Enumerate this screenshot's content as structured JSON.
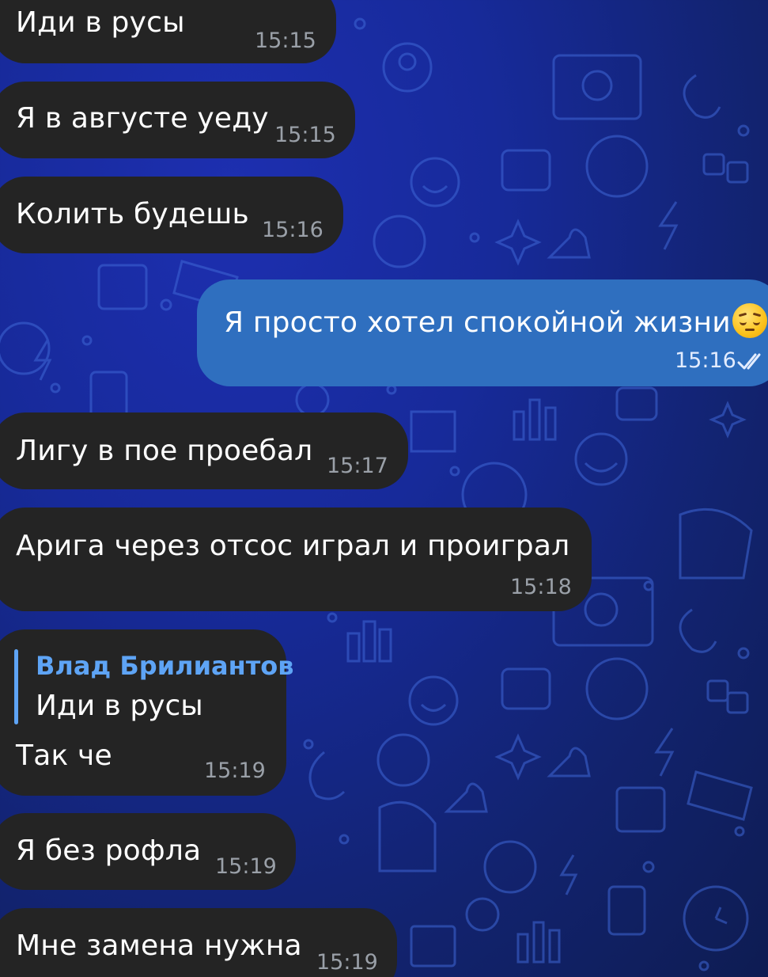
{
  "messages": [
    {
      "direction": "in",
      "text": "Иди в русы",
      "time": "15:15"
    },
    {
      "direction": "in",
      "text": "Я в августе уеду",
      "time": "15:15"
    },
    {
      "direction": "in",
      "text": "Колить будешь",
      "time": "15:16"
    },
    {
      "direction": "out",
      "text": "Я просто хотел спокойной жизни",
      "emoji": "pensive-face",
      "time": "15:16",
      "status": "read"
    },
    {
      "direction": "in",
      "text": "Лигу в пое проебал",
      "time": "15:17"
    },
    {
      "direction": "in",
      "text": "Арига через отсос играл и проиграл",
      "time": "15:18"
    },
    {
      "direction": "in",
      "reply_to": {
        "author": "Влад Брилиантов",
        "text": "Иди в русы"
      },
      "text": "Так че",
      "time": "15:19"
    },
    {
      "direction": "in",
      "text": "Я без рофла",
      "time": "15:19"
    },
    {
      "direction": "in",
      "text": "Мне замена нужна",
      "time": "15:19"
    }
  ],
  "colors": {
    "incoming_bubble": "#242424",
    "outgoing_bubble": "#2f6fbf",
    "reply_accent": "#5ea4f5",
    "wallpaper": "#172a9a"
  }
}
